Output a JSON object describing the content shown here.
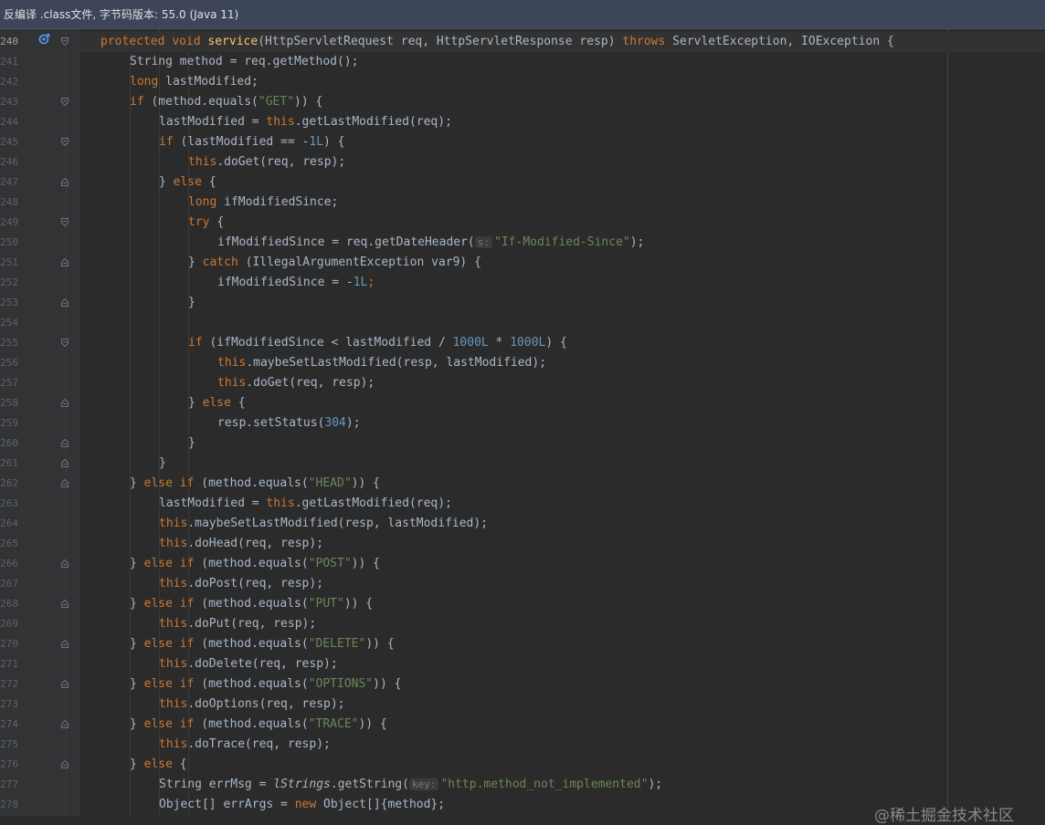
{
  "banner": {
    "text": "反编译 .class文件, 字节码版本: 55.0 (Java 11)"
  },
  "watermark": "@稀土掘金技术社区",
  "colors": {
    "keyword": "#cc7832",
    "string": "#6a8759",
    "number": "#6897bb",
    "method_decl": "#ffc66d",
    "plain": "#a9b7c6",
    "background": "#2b2b2b",
    "gutter": "#313335"
  },
  "icons": {
    "gutter_override": "overrides-method-icon",
    "fold": "fold-marker-icon"
  },
  "code_lines": [
    {
      "num": "240",
      "indent": 0,
      "fold": "open",
      "tokens": [
        [
          "k",
          "protected void "
        ],
        [
          "m",
          "service"
        ],
        [
          "p",
          "(HttpServletRequest req, HttpServletResponse resp) "
        ],
        [
          "k",
          "throws "
        ],
        [
          "p",
          "ServletException, IOException {"
        ]
      ]
    },
    {
      "num": "241",
      "indent": 1,
      "tokens": [
        [
          "p",
          "String method = req.getMethod();"
        ]
      ]
    },
    {
      "num": "242",
      "indent": 1,
      "tokens": [
        [
          "k",
          "long "
        ],
        [
          "p",
          "lastModified;"
        ]
      ]
    },
    {
      "num": "243",
      "indent": 1,
      "fold": "open",
      "tokens": [
        [
          "k",
          "if "
        ],
        [
          "p",
          "(method.equals("
        ],
        [
          "s",
          "\"GET\""
        ],
        [
          "p",
          ")) {"
        ]
      ]
    },
    {
      "num": "244",
      "indent": 2,
      "tokens": [
        [
          "p",
          "lastModified = "
        ],
        [
          "k",
          "this"
        ],
        [
          "p",
          ".getLastModified(req);"
        ]
      ]
    },
    {
      "num": "245",
      "indent": 2,
      "fold": "open",
      "tokens": [
        [
          "k",
          "if "
        ],
        [
          "p",
          "(lastModified == -"
        ],
        [
          "n",
          "1L"
        ],
        [
          "p",
          ") {"
        ]
      ]
    },
    {
      "num": "246",
      "indent": 3,
      "tokens": [
        [
          "k",
          "this"
        ],
        [
          "p",
          ".doGet(req, resp);"
        ]
      ]
    },
    {
      "num": "247",
      "indent": 2,
      "fold": "close",
      "tokens": [
        [
          "p",
          "} "
        ],
        [
          "k",
          "else "
        ],
        [
          "p",
          "{"
        ]
      ]
    },
    {
      "num": "248",
      "indent": 3,
      "tokens": [
        [
          "k",
          "long "
        ],
        [
          "p",
          "ifModifiedSince;"
        ]
      ]
    },
    {
      "num": "249",
      "indent": 3,
      "fold": "open",
      "tokens": [
        [
          "k",
          "try "
        ],
        [
          "p",
          "{"
        ]
      ]
    },
    {
      "num": "250",
      "indent": 4,
      "tokens": [
        [
          "p",
          "ifModifiedSince = req.getDateHeader("
        ],
        [
          "h",
          "s:"
        ],
        [
          "s",
          "\"If-Modified-Since\""
        ],
        [
          "p",
          ");"
        ]
      ]
    },
    {
      "num": "251",
      "indent": 3,
      "fold": "close",
      "tokens": [
        [
          "p",
          "} "
        ],
        [
          "k",
          "catch "
        ],
        [
          "p",
          "(IllegalArgumentException var9) {"
        ]
      ]
    },
    {
      "num": "252",
      "indent": 4,
      "tokens": [
        [
          "p",
          "ifModifiedSince = -"
        ],
        [
          "n",
          "1L"
        ],
        [
          "k",
          ";"
        ]
      ]
    },
    {
      "num": "253",
      "indent": 3,
      "fold": "close",
      "tokens": [
        [
          "p",
          "}"
        ]
      ]
    },
    {
      "num": "254",
      "indent": 0,
      "tokens": []
    },
    {
      "num": "255",
      "indent": 3,
      "fold": "open",
      "tokens": [
        [
          "k",
          "if "
        ],
        [
          "p",
          "(ifModifiedSince < lastModified / "
        ],
        [
          "n",
          "1000L"
        ],
        [
          "p",
          " * "
        ],
        [
          "n",
          "1000L"
        ],
        [
          "p",
          ") {"
        ]
      ]
    },
    {
      "num": "256",
      "indent": 4,
      "tokens": [
        [
          "k",
          "this"
        ],
        [
          "p",
          ".maybeSetLastModified(resp, lastModified);"
        ]
      ]
    },
    {
      "num": "257",
      "indent": 4,
      "tokens": [
        [
          "k",
          "this"
        ],
        [
          "p",
          ".doGet(req, resp);"
        ]
      ]
    },
    {
      "num": "258",
      "indent": 3,
      "fold": "close",
      "tokens": [
        [
          "p",
          "} "
        ],
        [
          "k",
          "else "
        ],
        [
          "p",
          "{"
        ]
      ]
    },
    {
      "num": "259",
      "indent": 4,
      "tokens": [
        [
          "p",
          "resp.setStatus("
        ],
        [
          "n",
          "304"
        ],
        [
          "p",
          ");"
        ]
      ]
    },
    {
      "num": "260",
      "indent": 3,
      "fold": "close",
      "tokens": [
        [
          "p",
          "}"
        ]
      ]
    },
    {
      "num": "261",
      "indent": 2,
      "fold": "close",
      "tokens": [
        [
          "p",
          "}"
        ]
      ]
    },
    {
      "num": "262",
      "indent": 1,
      "fold": "close",
      "tokens": [
        [
          "p",
          "} "
        ],
        [
          "k",
          "else if "
        ],
        [
          "p",
          "(method.equals("
        ],
        [
          "s",
          "\"HEAD\""
        ],
        [
          "p",
          ")) {"
        ]
      ]
    },
    {
      "num": "263",
      "indent": 2,
      "tokens": [
        [
          "p",
          "lastModified = "
        ],
        [
          "k",
          "this"
        ],
        [
          "p",
          ".getLastModified(req);"
        ]
      ]
    },
    {
      "num": "264",
      "indent": 2,
      "tokens": [
        [
          "k",
          "this"
        ],
        [
          "p",
          ".maybeSetLastModified(resp, lastModified);"
        ]
      ]
    },
    {
      "num": "265",
      "indent": 2,
      "tokens": [
        [
          "k",
          "this"
        ],
        [
          "p",
          ".doHead(req, resp);"
        ]
      ]
    },
    {
      "num": "266",
      "indent": 1,
      "fold": "close",
      "tokens": [
        [
          "p",
          "} "
        ],
        [
          "k",
          "else if "
        ],
        [
          "p",
          "(method.equals("
        ],
        [
          "s",
          "\"POST\""
        ],
        [
          "p",
          ")) {"
        ]
      ]
    },
    {
      "num": "267",
      "indent": 2,
      "tokens": [
        [
          "k",
          "this"
        ],
        [
          "p",
          ".doPost(req, resp);"
        ]
      ]
    },
    {
      "num": "268",
      "indent": 1,
      "fold": "close",
      "tokens": [
        [
          "p",
          "} "
        ],
        [
          "k",
          "else if "
        ],
        [
          "p",
          "(method.equals("
        ],
        [
          "s",
          "\"PUT\""
        ],
        [
          "p",
          ")) {"
        ]
      ]
    },
    {
      "num": "269",
      "indent": 2,
      "tokens": [
        [
          "k",
          "this"
        ],
        [
          "p",
          ".doPut(req, resp);"
        ]
      ]
    },
    {
      "num": "270",
      "indent": 1,
      "fold": "close",
      "tokens": [
        [
          "p",
          "} "
        ],
        [
          "k",
          "else if "
        ],
        [
          "p",
          "(method.equals("
        ],
        [
          "s",
          "\"DELETE\""
        ],
        [
          "p",
          ")) {"
        ]
      ]
    },
    {
      "num": "271",
      "indent": 2,
      "tokens": [
        [
          "k",
          "this"
        ],
        [
          "p",
          ".doDelete(req, resp);"
        ]
      ]
    },
    {
      "num": "272",
      "indent": 1,
      "fold": "close",
      "tokens": [
        [
          "p",
          "} "
        ],
        [
          "k",
          "else if "
        ],
        [
          "p",
          "(method.equals("
        ],
        [
          "s",
          "\"OPTIONS\""
        ],
        [
          "p",
          ")) {"
        ]
      ]
    },
    {
      "num": "273",
      "indent": 2,
      "tokens": [
        [
          "k",
          "this"
        ],
        [
          "p",
          ".doOptions(req, resp);"
        ]
      ]
    },
    {
      "num": "274",
      "indent": 1,
      "fold": "close",
      "tokens": [
        [
          "p",
          "} "
        ],
        [
          "k",
          "else if "
        ],
        [
          "p",
          "(method.equals("
        ],
        [
          "s",
          "\"TRACE\""
        ],
        [
          "p",
          ")) {"
        ]
      ]
    },
    {
      "num": "275",
      "indent": 2,
      "tokens": [
        [
          "k",
          "this"
        ],
        [
          "p",
          ".doTrace(req, resp);"
        ]
      ]
    },
    {
      "num": "276",
      "indent": 1,
      "fold": "close",
      "tokens": [
        [
          "p",
          "} "
        ],
        [
          "k",
          "else "
        ],
        [
          "p",
          "{"
        ]
      ]
    },
    {
      "num": "277",
      "indent": 2,
      "tokens": [
        [
          "p",
          "String errMsg = "
        ],
        [
          "i",
          "lStrings"
        ],
        [
          "p",
          ".getString("
        ],
        [
          "h",
          "key:"
        ],
        [
          "s",
          "\"http.method_not_implemented\""
        ],
        [
          "p",
          ");"
        ]
      ]
    },
    {
      "num": "278",
      "indent": 2,
      "tokens": [
        [
          "p",
          "Object[] errArgs = "
        ],
        [
          "k",
          "new "
        ],
        [
          "p",
          "Object[]{method};"
        ]
      ]
    }
  ]
}
